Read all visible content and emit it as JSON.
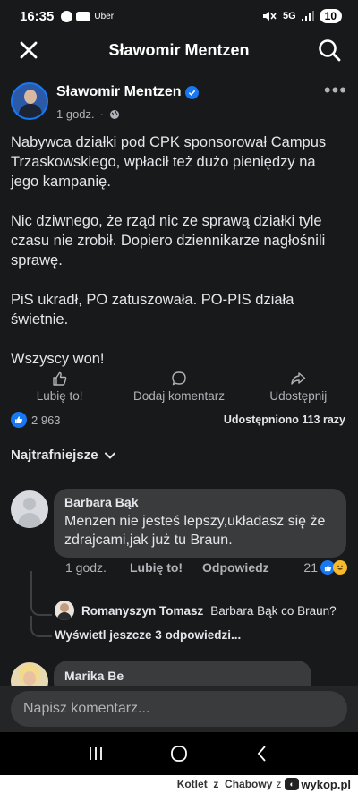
{
  "status_bar": {
    "time": "16:35",
    "left_app_label": "Uber",
    "network": "5G",
    "battery": "10"
  },
  "header": {
    "title": "Sławomir Mentzen"
  },
  "post": {
    "author": "Sławomir Mentzen",
    "time": "1 godz.",
    "paragraphs": [
      "Nabywca działki pod CPK sponsorował Campus Trzaskowskiego, wpłacił też dużo pieniędzy na jego kampanię.",
      "Nic dziwnego, że rząd nic ze sprawą działki tyle czasu nie zrobił. Dopiero dziennikarze nagłośnili sprawę.",
      "PiS ukradł, PO zatuszowała. PO-PIS działa świetnie.",
      "Wszyscy won!"
    ],
    "actions": {
      "like": "Lubię to!",
      "comment": "Dodaj komentarz",
      "share": "Udostępnij"
    },
    "reaction_count": "2 963",
    "shares": "Udostępniono 113 razy"
  },
  "comments_sort": "Najtrafniejsze",
  "comments": [
    {
      "author": "Barbara Bąk",
      "text": "Menzen nie jesteś lepszy,układasz się że zdrajcami,jak już tu Braun.",
      "time": "1 godz.",
      "like_label": "Lubię to!",
      "reply_label": "Odpowiedz",
      "reaction_count": "21",
      "reply": {
        "author": "Romanyszyn Tomasz",
        "text": "Barbara Bąk co Braun?"
      },
      "more_replies": "Wyświetl jeszcze 3 odpowiedzi..."
    },
    {
      "author": "Marika Be"
    }
  ],
  "composer": {
    "placeholder": "Napisz komentarz..."
  },
  "footer": {
    "user": "Kotlet_z_Chabowy",
    "connector": "z",
    "site": "wykop.pl"
  },
  "colors": {
    "background": "#18191a",
    "bubble": "#3a3b3c",
    "accent": "#1877f2"
  }
}
